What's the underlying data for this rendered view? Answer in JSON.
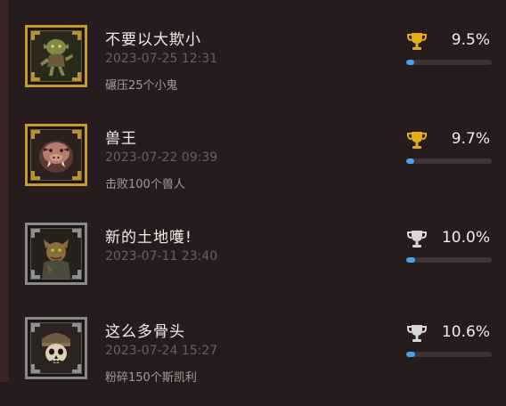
{
  "achievements": [
    {
      "title": "不要以大欺小",
      "date": "2023-07-25 12:31",
      "description": "碾压25个小鬼",
      "percent": "9.5%",
      "progress": 0.095,
      "trophy": "gold-trophy-icon",
      "frame": "gold",
      "image": "goblin-badge-icon"
    },
    {
      "title": "兽王",
      "date": "2023-07-22 09:39",
      "description": "击败100个兽人",
      "percent": "9.7%",
      "progress": 0.097,
      "trophy": "gold-trophy-icon",
      "frame": "gold",
      "image": "boar-orc-badge-icon"
    },
    {
      "title": "新的土地嚄!",
      "date": "2023-07-11 23:40",
      "description": "",
      "percent": "10.0%",
      "progress": 0.1,
      "trophy": "silver-trophy-icon",
      "frame": "silver",
      "image": "orc-warrior-badge-icon"
    },
    {
      "title": "这么多骨头",
      "date": "2023-07-24 15:27",
      "description": "粉碎150个斯凯利",
      "percent": "10.6%",
      "progress": 0.106,
      "trophy": "silver-trophy-icon",
      "frame": "silver",
      "image": "skeleton-badge-icon"
    }
  ],
  "colors": {
    "background": "#261c1d",
    "gold": "#e6ac17",
    "silver": "#d7d7d7",
    "progress_fill": "#4aa3e8",
    "progress_track": "#3d3436"
  }
}
